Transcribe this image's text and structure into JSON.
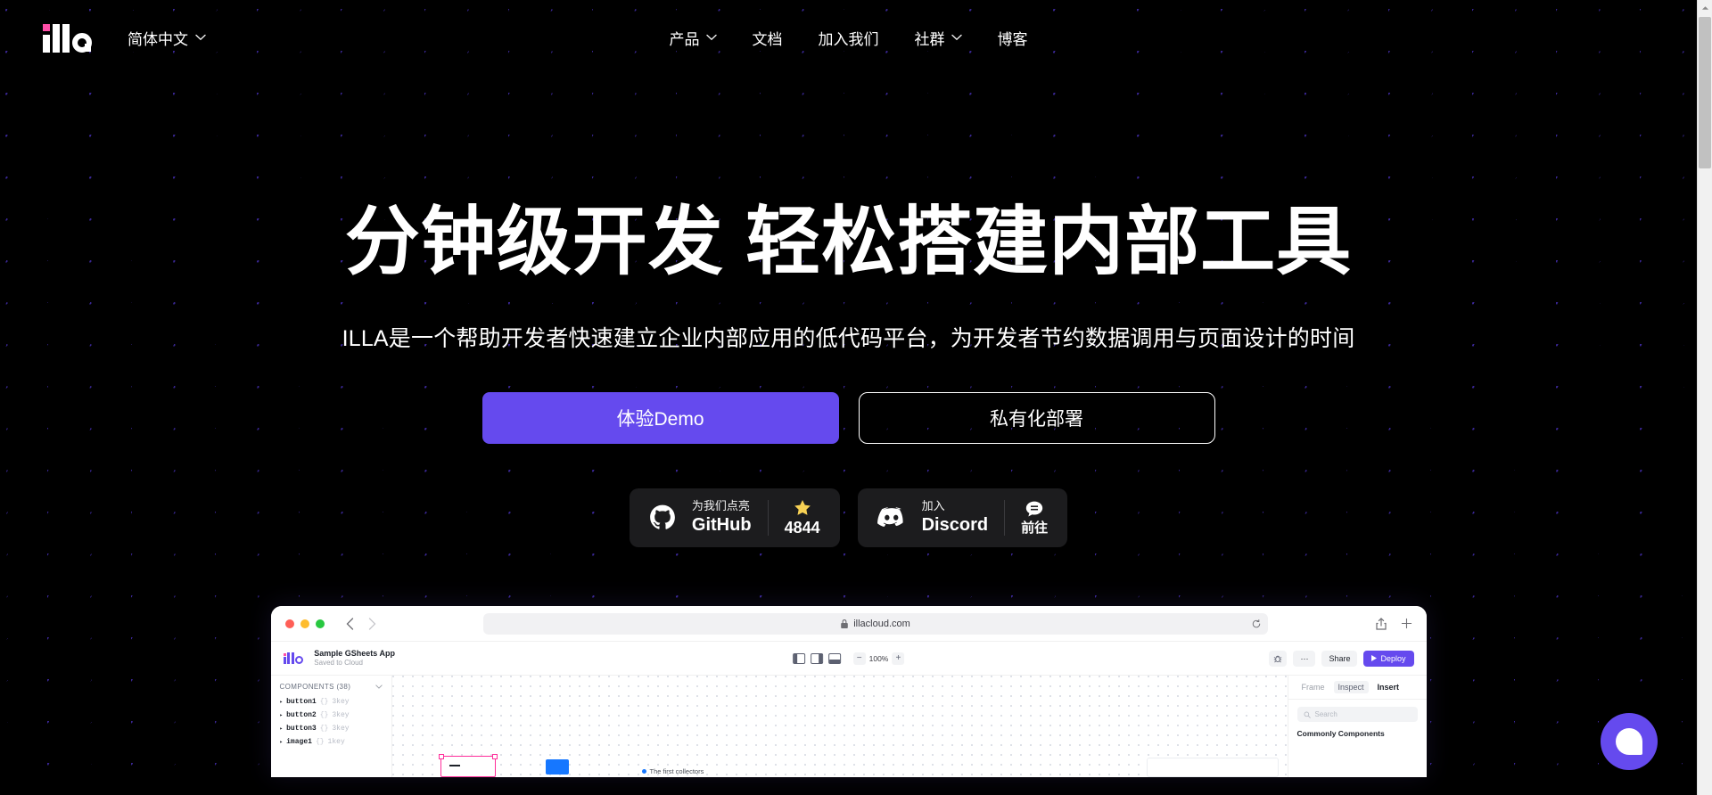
{
  "brand": {
    "logo_name": "illa-logo",
    "accent_purple": "#654AEE",
    "accent_pink": "#FF4EA8"
  },
  "nav": {
    "language_label": "简体中文",
    "items": [
      {
        "label": "产品",
        "has_dropdown": true
      },
      {
        "label": "文档",
        "has_dropdown": false
      },
      {
        "label": "加入我们",
        "has_dropdown": false
      },
      {
        "label": "社群",
        "has_dropdown": true
      },
      {
        "label": "博客",
        "has_dropdown": false
      }
    ]
  },
  "hero": {
    "headline": "分钟级开发 轻松搭建内部工具",
    "subheadline": "ILLA是一个帮助开发者快速建立企业内部应用的低代码平台，为开发者节约数据调用与页面设计的时间",
    "primary_cta": "体验Demo",
    "secondary_cta": "私有化部署"
  },
  "social": {
    "github": {
      "small_label": "为我们点亮",
      "big_label": "GitHub",
      "star_count": "4844"
    },
    "discord": {
      "small_label": "加入",
      "big_label": "Discord",
      "action_label": "前往"
    }
  },
  "mockup": {
    "browser": {
      "url": "illacloud.com"
    },
    "app_header": {
      "app_name": "Sample GSheets App",
      "save_status": "Saved to Cloud",
      "zoom_level": "100%",
      "zoom_out": "−",
      "zoom_in": "+",
      "more_label": "···",
      "share_label": "Share",
      "deploy_label": "Deploy"
    },
    "left_panel": {
      "section_title": "COMPONENTS (38)",
      "items": [
        {
          "name": "button1",
          "braces": "{}",
          "keys": "3key"
        },
        {
          "name": "button2",
          "braces": "{}",
          "keys": "3key"
        },
        {
          "name": "button3",
          "braces": "{}",
          "keys": "3key"
        },
        {
          "name": "image1",
          "braces": "{}",
          "keys": "1key"
        }
      ]
    },
    "canvas": {
      "text_item": "The first collectors"
    },
    "right_panel": {
      "tabs": [
        {
          "label": "Frame",
          "state": "default"
        },
        {
          "label": "Inspect",
          "state": "hover"
        },
        {
          "label": "Insert",
          "state": "active"
        }
      ],
      "search_placeholder": "Search",
      "section_title": "Commonly Components"
    }
  },
  "chat": {
    "widget_label": "chat"
  }
}
